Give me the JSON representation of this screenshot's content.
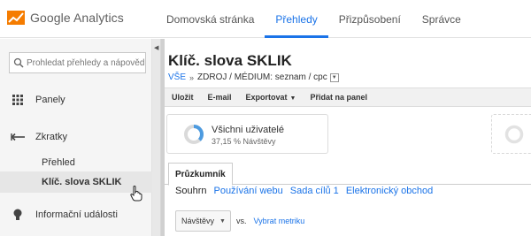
{
  "brand": {
    "name": "Google Analytics"
  },
  "nav": {
    "items": [
      {
        "label": "Domovská stránka"
      },
      {
        "label": "Přehledy"
      },
      {
        "label": "Přizpůsobení"
      },
      {
        "label": "Správce"
      }
    ],
    "active_index": 1
  },
  "sidebar": {
    "search_placeholder": "Prohledat přehledy a nápovědu",
    "items": [
      {
        "label": "Panely",
        "icon": "grid-icon"
      },
      {
        "label": "Zkratky",
        "icon": "shortcut-arrow-icon"
      },
      {
        "label": "Informační události",
        "icon": "lightbulb-icon"
      }
    ],
    "subitems": [
      {
        "label": "Přehled"
      },
      {
        "label": "Klíč. slova SKLIK"
      }
    ],
    "active_subitem": "Klíč. slova SKLIK"
  },
  "report": {
    "title": "Klíč. slova SKLIK",
    "breadcrumb_all": "VŠE",
    "breadcrumb_sep": "»",
    "breadcrumb_filter": "ZDROJ / MÉDIUM: seznam / cpc"
  },
  "toolbar": {
    "save": "Uložit",
    "email": "E-mail",
    "export": "Exportovat",
    "add_dashboard": "Přidat na panel"
  },
  "segment": {
    "name": "Všichni uživatelé",
    "percent_text": "37,15 % Návštěvy",
    "percent_value": 37.15,
    "accent": "#4d9be0"
  },
  "tabs": [
    {
      "label": "Průzkumník"
    }
  ],
  "subtabs": [
    {
      "label": "Souhrn"
    },
    {
      "label": "Používání webu"
    },
    {
      "label": "Sada cílů 1"
    },
    {
      "label": "Elektronický obchod"
    }
  ],
  "metric": {
    "selected": "Návštěvy",
    "vs": "vs.",
    "pick_label": "Vybrat metriku"
  },
  "colors": {
    "link": "#1a73e8",
    "brand_orange": "#f57c00"
  }
}
